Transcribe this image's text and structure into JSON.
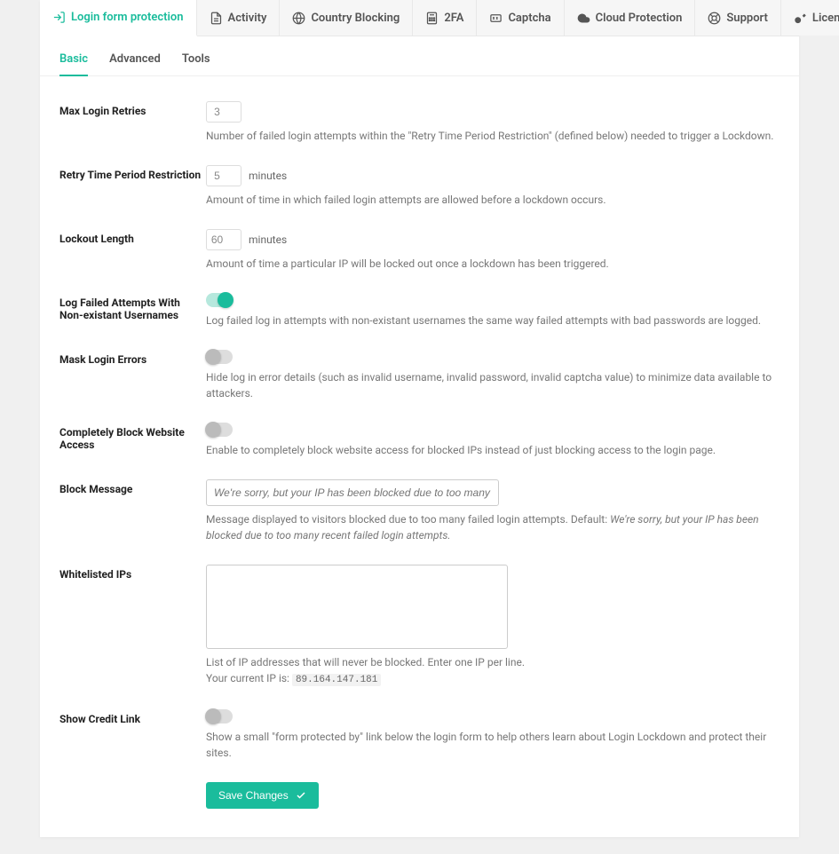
{
  "topTabs": [
    {
      "label": "Login form protection",
      "icon": "login"
    },
    {
      "label": "Activity",
      "icon": "activity"
    },
    {
      "label": "Country Blocking",
      "icon": "globe"
    },
    {
      "label": "2FA",
      "icon": "calc"
    },
    {
      "label": "Captcha",
      "icon": "captcha"
    },
    {
      "label": "Cloud Protection",
      "icon": "cloud"
    },
    {
      "label": "Support",
      "icon": "support"
    },
    {
      "label": "License",
      "icon": "key"
    }
  ],
  "activeTopTab": 0,
  "subTabs": [
    "Basic",
    "Advanced",
    "Tools"
  ],
  "activeSubTab": 0,
  "fields": {
    "maxRetries": {
      "label": "Max Login Retries",
      "value": 3,
      "desc": "Number of failed login attempts within the \"Retry Time Period Restriction\" (defined below) needed to trigger a Lockdown."
    },
    "retryPeriod": {
      "label": "Retry Time Period Restriction",
      "value": 5,
      "unit": "minutes",
      "desc": "Amount of time in which failed login attempts are allowed before a lockdown occurs."
    },
    "lockoutLength": {
      "label": "Lockout Length",
      "value": 60,
      "unit": "minutes",
      "desc": "Amount of time a particular IP will be locked out once a lockdown has been triggered."
    },
    "logFailed": {
      "label": "Log Failed Attempts With Non-existant Usernames",
      "on": true,
      "desc": "Log failed log in attempts with non-existant usernames the same way failed attempts with bad passwords are logged."
    },
    "maskErrors": {
      "label": "Mask Login Errors",
      "on": false,
      "desc": "Hide log in error details (such as invalid username, invalid password, invalid captcha value) to minimize data available to attackers."
    },
    "blockAccess": {
      "label": "Completely Block Website Access",
      "on": false,
      "desc": "Enable to completely block website access for blocked IPs instead of just blocking access to the login page."
    },
    "blockMessage": {
      "label": "Block Message",
      "placeholder": "We're sorry, but your IP has been blocked due to too many recent failed login attempts.",
      "descPrefix": "Message displayed to visitors blocked due to too many failed login attempts. Default: ",
      "descDefault": "We're sorry, but your IP has been blocked due to too many recent failed login attempts."
    },
    "whitelist": {
      "label": "Whitelisted IPs",
      "value": "",
      "desc": "List of IP addresses that will never be blocked. Enter one IP per line.",
      "ipPrefix": "Your current IP is: ",
      "ip": "89.164.147.181"
    },
    "creditLink": {
      "label": "Show Credit Link",
      "on": false,
      "desc": "Show a small \"form protected by\" link below the login form to help others learn about Login Lockdown and protect their sites."
    }
  },
  "saveLabel": "Save Changes"
}
